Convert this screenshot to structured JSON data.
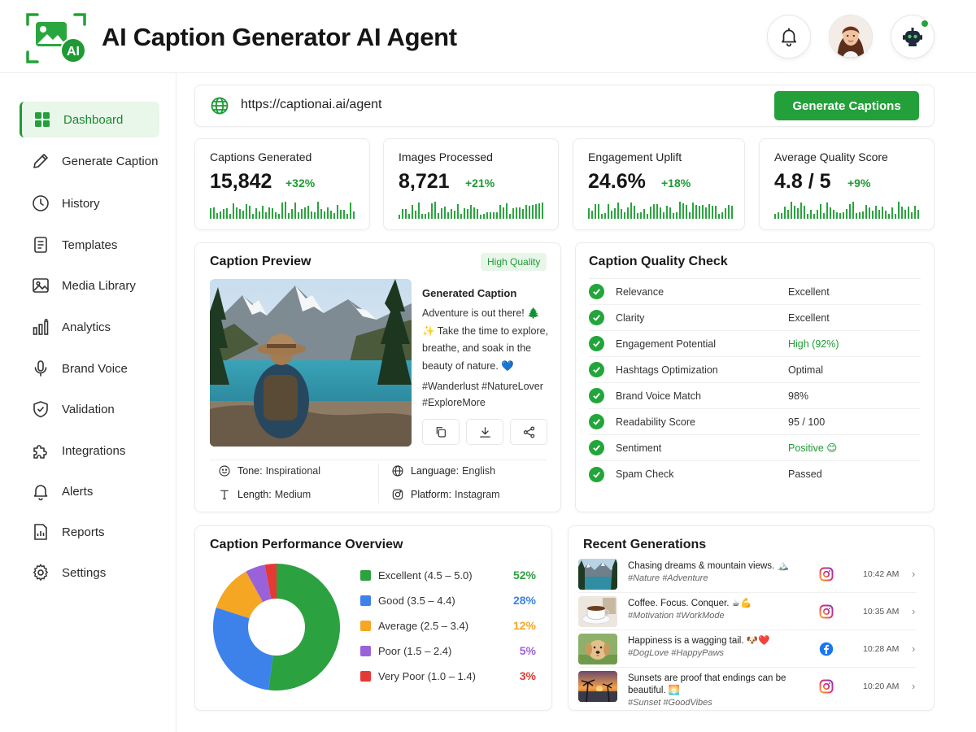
{
  "app": {
    "title": "AI Caption Generator AI Agent",
    "logo_badge": "AI"
  },
  "header": {
    "notifications_icon": "bell-icon",
    "avatar": "user-avatar",
    "agent_icon": "robot-icon"
  },
  "sidebar": {
    "items": [
      {
        "label": "Dashboard",
        "icon": "dashboard-icon",
        "active": true
      },
      {
        "label": "Generate Caption",
        "icon": "pencil-icon"
      },
      {
        "label": "History",
        "icon": "clock-icon"
      },
      {
        "label": "Templates",
        "icon": "document-icon"
      },
      {
        "label": "Media Library",
        "icon": "image-icon"
      },
      {
        "label": "Analytics",
        "icon": "bar-chart-icon"
      },
      {
        "label": "Brand Voice",
        "icon": "microphone-icon"
      },
      {
        "label": "Validation",
        "icon": "shield-check-icon"
      },
      {
        "label": "Integrations",
        "icon": "puzzle-icon"
      },
      {
        "label": "Alerts",
        "icon": "bell-icon"
      },
      {
        "label": "Reports",
        "icon": "report-icon"
      },
      {
        "label": "Settings",
        "icon": "gear-icon"
      }
    ]
  },
  "url_bar": {
    "url": "https://captionai.ai/agent",
    "button_label": "Generate Captions"
  },
  "stats": [
    {
      "label": "Captions Generated",
      "value": "15,842",
      "delta": "+32%"
    },
    {
      "label": "Images Processed",
      "value": "8,721",
      "delta": "+21%"
    },
    {
      "label": "Engagement Uplift",
      "value": "24.6%",
      "delta": "+18%"
    },
    {
      "label": "Average Quality Score",
      "value": "4.8 / 5",
      "delta": "+9%"
    }
  ],
  "preview": {
    "title": "Caption Preview",
    "badge": "High Quality",
    "caption_title": "Generated Caption",
    "caption_text": "Adventure is out there! 🌲✨ Take the time to explore, breathe, and soak in the beauty of nature. 💙",
    "hashtags": "#Wanderlust #NatureLover #ExploreMore",
    "tone_label": "Tone:",
    "tone": "Inspirational",
    "language_label": "Language:",
    "language": "English",
    "length_label": "Length:",
    "length": "Medium",
    "platform_label": "Platform:",
    "platform": "Instagram"
  },
  "quality": {
    "title": "Caption Quality Check",
    "rows": [
      {
        "label": "Relevance",
        "value": "Excellent",
        "highlight": false
      },
      {
        "label": "Clarity",
        "value": "Excellent",
        "highlight": false
      },
      {
        "label": "Engagement Potential",
        "value": "High (92%)",
        "highlight": true
      },
      {
        "label": "Hashtags Optimization",
        "value": "Optimal",
        "highlight": false
      },
      {
        "label": "Brand Voice Match",
        "value": "98%",
        "highlight": false
      },
      {
        "label": "Readability Score",
        "value": "95 / 100",
        "highlight": false
      },
      {
        "label": "Sentiment",
        "value": "Positive 😊",
        "highlight": true
      },
      {
        "label": "Spam Check",
        "value": "Passed",
        "highlight": false
      }
    ]
  },
  "performance": {
    "title": "Caption Performance Overview",
    "legend": [
      {
        "label": "Excellent (4.5 – 5.0)",
        "pct": "52%",
        "color": "#2ba13f"
      },
      {
        "label": "Good (3.5 – 4.4)",
        "pct": "28%",
        "color": "#3d82ea"
      },
      {
        "label": "Average (2.5 – 3.4)",
        "pct": "12%",
        "color": "#f5a623"
      },
      {
        "label": "Poor (1.5 – 2.4)",
        "pct": "5%",
        "color": "#9a62d8"
      },
      {
        "label": "Very Poor (1.0 – 1.4)",
        "pct": "3%",
        "color": "#e53935"
      }
    ]
  },
  "chart_data": {
    "type": "pie",
    "categories": [
      "Excellent (4.5 – 5.0)",
      "Good (3.5 – 4.4)",
      "Average (2.5 – 3.4)",
      "Poor (1.5 – 2.4)",
      "Very Poor (1.0 – 1.4)"
    ],
    "values": [
      52,
      28,
      12,
      5,
      3
    ],
    "colors": [
      "#2ba13f",
      "#3d82ea",
      "#f5a623",
      "#9a62d8",
      "#e53935"
    ],
    "title": "Caption Performance Overview",
    "donut": true
  },
  "recent": {
    "title": "Recent Generations",
    "items": [
      {
        "text": "Chasing dreams & mountain views. 🏔️",
        "tags": "#Nature #Adventure",
        "platform": "instagram-icon",
        "time": "10:42 AM"
      },
      {
        "text": "Coffee. Focus. Conquer. ☕💪",
        "tags": "#Motivation #WorkMode",
        "platform": "instagram-icon",
        "time": "10:35 AM"
      },
      {
        "text": "Happiness is a wagging tail. 🐶❤️",
        "tags": "#DogLove #HappyPaws",
        "platform": "facebook-icon",
        "time": "10:28 AM"
      },
      {
        "text": "Sunsets are proof that endings can be beautiful. 🌅",
        "tags": "#Sunset #GoodVibes",
        "platform": "instagram-icon",
        "time": "10:20 AM"
      }
    ]
  }
}
